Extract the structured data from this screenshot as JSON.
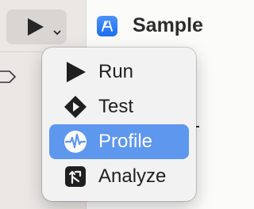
{
  "window": {
    "title": "Sample"
  },
  "toolbar": {
    "run_button_icon": "play-icon",
    "run_button_chevron_icon": "chevron-down-icon",
    "app_icon": "app-store-icon"
  },
  "menu": {
    "items": [
      {
        "label": "Run",
        "icon": "run-play-icon",
        "selected": false
      },
      {
        "label": "Test",
        "icon": "test-diamond-icon",
        "selected": false
      },
      {
        "label": "Profile",
        "icon": "profile-waveform-icon",
        "selected": true
      },
      {
        "label": "Analyze",
        "icon": "analyze-icon",
        "selected": false
      }
    ]
  },
  "colors": {
    "selection": "#5d97ee",
    "sidebar": "#ebe7e4",
    "menu_background": "#f2f2f2"
  }
}
